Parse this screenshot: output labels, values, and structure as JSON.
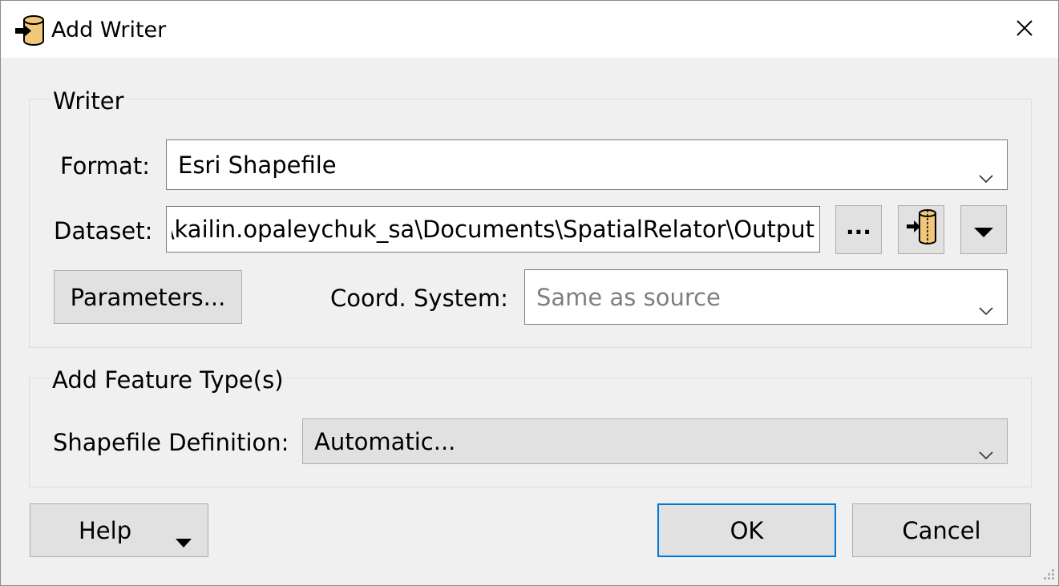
{
  "window": {
    "title": "Add Writer"
  },
  "writer_group": {
    "title": "Writer",
    "format": {
      "label": "Format:",
      "value": "Esri Shapefile"
    },
    "dataset": {
      "label": "Dataset:",
      "value": "C:\\Users\\kailin.opaleychuk_sa\\Documents\\SpatialRelator\\Output",
      "browse_label": "..."
    },
    "parameters_label": "Parameters...",
    "coord_system": {
      "label": "Coord. System:",
      "placeholder": "Same as source"
    }
  },
  "feature_group": {
    "title": "Add Feature Type(s)",
    "definition": {
      "label": "Shapefile Definition:",
      "value": "Automatic..."
    }
  },
  "footer": {
    "help_label": "Help",
    "ok_label": "OK",
    "cancel_label": "Cancel"
  },
  "colors": {
    "accent": "#0078d7",
    "icon_fill": "#f3c77a",
    "background": "#f0f0f0"
  },
  "icons": [
    "writer-database-icon",
    "close-icon",
    "chevron-down-icon",
    "ellipsis-icon",
    "zip-archive-icon",
    "triangle-down-icon",
    "resize-grip-icon"
  ]
}
